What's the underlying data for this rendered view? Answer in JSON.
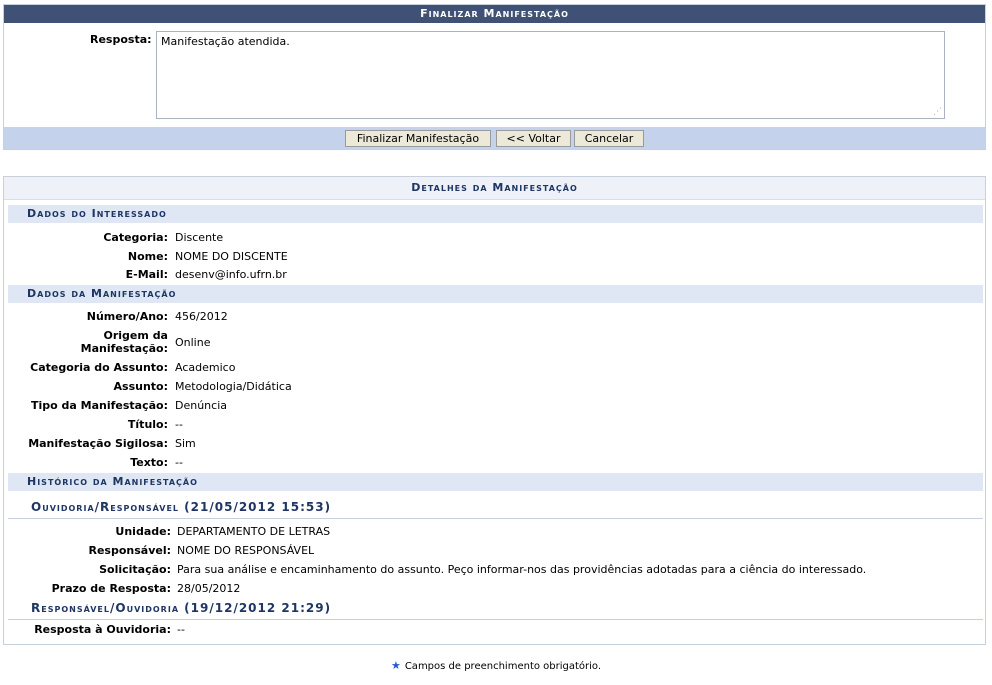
{
  "form": {
    "title": "Finalizar Manifestação",
    "resposta_label": "Resposta:",
    "resposta_value": "Manifestação atendida.",
    "buttons": {
      "finalizar": "Finalizar Manifestação",
      "voltar": "<< Voltar",
      "cancelar": "Cancelar"
    }
  },
  "details": {
    "title": "Detalhes da Manifestação",
    "interessado": {
      "title": "Dados do Interessado",
      "rows": [
        {
          "label": "Categoria:",
          "value": "Discente"
        },
        {
          "label": "Nome:",
          "value": "NOME DO DISCENTE"
        },
        {
          "label": "E-Mail:",
          "value": "desenv@info.ufrn.br"
        }
      ]
    },
    "manifestacao": {
      "title": "Dados da Manifestação",
      "rows": [
        {
          "label": "Número/Ano:",
          "value": "456/2012"
        },
        {
          "label": "Origem da Manifestação:",
          "value": "Online"
        },
        {
          "label": "Categoria do Assunto:",
          "value": "Academico"
        },
        {
          "label": "Assunto:",
          "value": "Metodologia/Didática"
        },
        {
          "label": "Tipo da Manifestação:",
          "value": "Denúncia"
        },
        {
          "label": "Título:",
          "value": "--"
        },
        {
          "label": "Manifestação Sigilosa:",
          "value": "Sim"
        },
        {
          "label": "Texto:",
          "value": "--"
        }
      ],
      "origem_line1": "Origem da",
      "origem_line2": "Manifestação:"
    },
    "historico": {
      "title": "Histórico da Manifestação",
      "entry1": {
        "heading": "Ouvidoria/Responsável (21/05/2012 15:53)",
        "rows": [
          {
            "label": "Unidade:",
            "value": "DEPARTAMENTO DE LETRAS"
          },
          {
            "label": "Responsável:",
            "value": "NOME DO RESPONSÁVEL"
          },
          {
            "label": "Solicitação:",
            "value": "Para sua análise e encaminhamento do assunto. Peço informar-nos das providências adotadas para a ciência do interessado."
          },
          {
            "label": "Prazo de Resposta:",
            "value": "28/05/2012"
          }
        ]
      },
      "entry2": {
        "heading": "Responsável/Ouvidoria (19/12/2012 21:29)",
        "rows": [
          {
            "label": "Resposta à Ouvidoria:",
            "value": "--"
          }
        ]
      }
    }
  },
  "footnote": {
    "text": "Campos de preenchimento obrigatório.",
    "icon": "star-icon",
    "icon_color": "#2a5ccc"
  }
}
